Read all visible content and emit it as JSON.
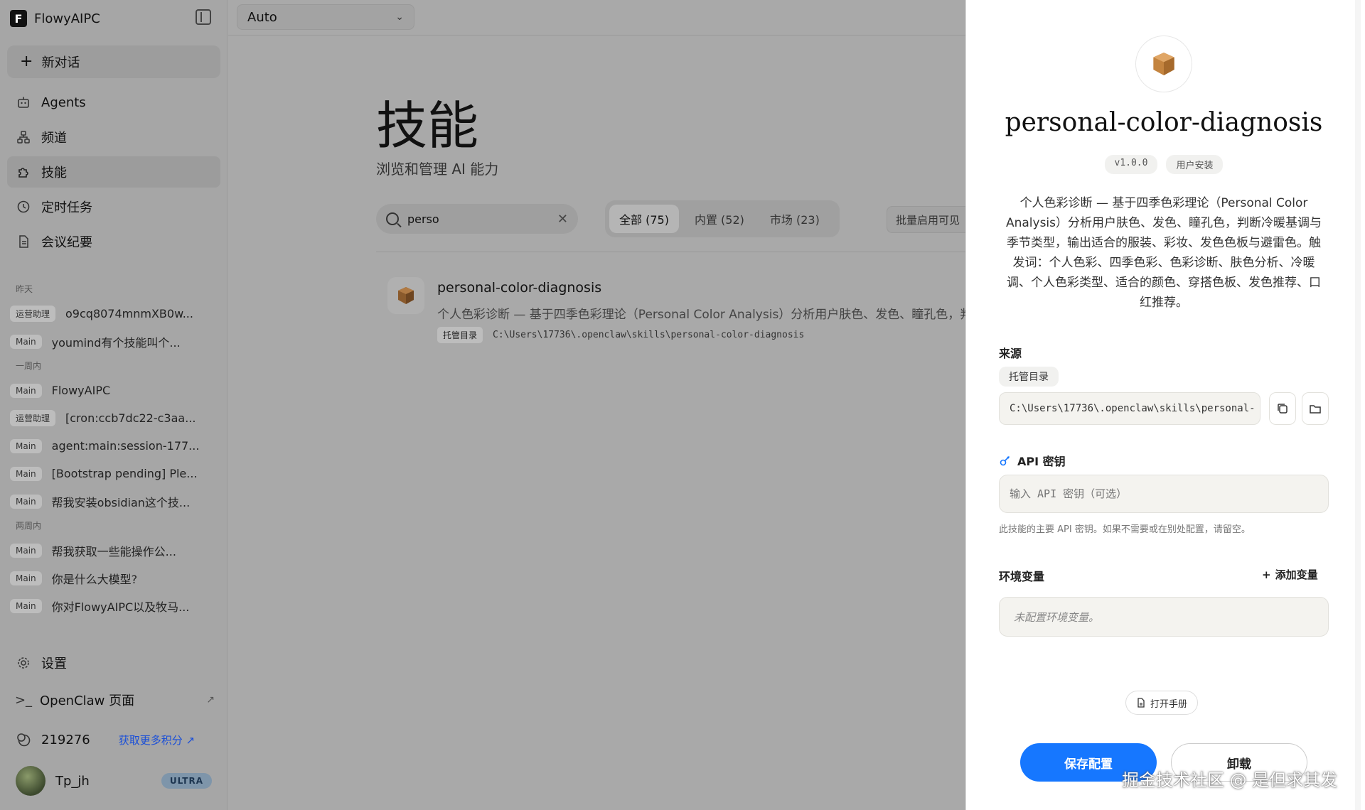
{
  "app": {
    "name": "FlowyAIPC"
  },
  "sidebar": {
    "new_chat": "新对话",
    "nav": [
      {
        "label": "Agents",
        "icon": "robot-icon"
      },
      {
        "label": "频道",
        "icon": "channel-icon"
      },
      {
        "label": "技能",
        "icon": "puzzle-icon",
        "active": true
      },
      {
        "label": "定时任务",
        "icon": "clock-icon"
      },
      {
        "label": "会议纪要",
        "icon": "note-icon"
      }
    ],
    "groups": [
      {
        "label": "昨天",
        "items": [
          {
            "tag": "运营助理",
            "text": "o9cq8074mnmXB0w..."
          },
          {
            "tag": "Main",
            "text": "youmind有个技能叫个..."
          }
        ]
      },
      {
        "label": "一周内",
        "items": [
          {
            "tag": "Main",
            "text": "FlowyAIPC"
          },
          {
            "tag": "运营助理",
            "text": "[cron:ccb7dc22-c3aa..."
          },
          {
            "tag": "Main",
            "text": "agent:main:session-177..."
          },
          {
            "tag": "Main",
            "text": "[Bootstrap pending] Ple..."
          },
          {
            "tag": "Main",
            "text": "帮我安装obsidian这个技..."
          }
        ]
      },
      {
        "label": "两周内",
        "items": [
          {
            "tag": "Main",
            "text": "帮我获取一些能操作公..."
          },
          {
            "tag": "Main",
            "text": "你是什么大模型?"
          },
          {
            "tag": "Main",
            "text": "你对FlowyAIPC以及牧马..."
          }
        ]
      }
    ],
    "settings": "设置",
    "openclaw": "OpenClaw 页面",
    "credits": {
      "value": "219276",
      "link": "获取更多积分"
    },
    "user": {
      "name": "Tp_jh",
      "plan": "ULTRA"
    }
  },
  "main": {
    "model": "Auto",
    "title": "技能",
    "subtitle": "浏览和管理 AI 能力",
    "search": {
      "value": "perso"
    },
    "tabs": [
      {
        "label": "全部 (75)",
        "active": true
      },
      {
        "label": "内置 (52)"
      },
      {
        "label": "市场 (23)"
      }
    ],
    "batch": "批量启用可见",
    "skill": {
      "name": "personal-color-diagnosis",
      "desc": "个人色彩诊断 — 基于四季色彩理论（Personal Color Analysis）分析用户肤色、发色、瞳孔色，判断冷暖基调",
      "tag": "托管目录",
      "path": "C:\\Users\\17736\\.openclaw\\skills\\personal-color-diagnosis"
    }
  },
  "panel": {
    "title": "personal-color-diagnosis",
    "version": "v1.0.0",
    "install_type": "用户安装",
    "description": "个人色彩诊断 — 基于四季色彩理论（Personal Color Analysis）分析用户肤色、发色、瞳孔色，判断冷暖基调与季节类型，输出适合的服装、彩妆、发色色板与避雷色。触发词：个人色彩、四季色彩、色彩诊断、肤色分析、冷暖调、个人色彩类型、适合的颜色、穿搭色板、发色推荐、口红推荐。",
    "source_label": "来源",
    "source_tag": "托管目录",
    "source_path": "C:\\Users\\17736\\.openclaw\\skills\\personal-",
    "api_label": "API 密钥",
    "api_placeholder": "输入 API 密钥（可选）",
    "api_hint": "此技能的主要 API 密钥。如果不需要或在别处配置，请留空。",
    "env_label": "环境变量",
    "add_var": "添加变量",
    "env_empty": "未配置环境变量。",
    "manual": "打开手册",
    "save": "保存配置",
    "uninstall": "卸载"
  },
  "watermark": "掘金技术社区 @ 是但求其发"
}
